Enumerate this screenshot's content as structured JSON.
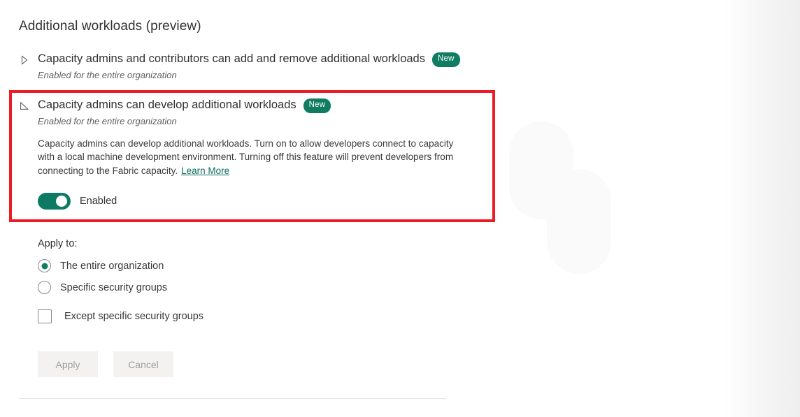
{
  "page": {
    "title": "Additional workloads (preview)"
  },
  "colors": {
    "accent_green": "#107c62",
    "toggle_on": "#0d7b63",
    "link": "#0f6b5c",
    "highlight_red": "#ed1c24",
    "text_primary": "#323130",
    "text_secondary": "#605e5c",
    "button_bg": "#f3f2f1",
    "button_text": "#a19f9d",
    "divider": "#e6e6e6"
  },
  "settings": [
    {
      "id": "capacity-admins-add-remove",
      "expanded": false,
      "expander_icon": "triangle-right-icon",
      "title": "Capacity admins and contributors can add and remove additional workloads",
      "badge": "New",
      "subtitle": "Enabled for the entire organization"
    },
    {
      "id": "capacity-admins-develop",
      "expanded": true,
      "expander_icon": "triangle-down-icon",
      "title": "Capacity admins can develop additional workloads",
      "badge": "New",
      "subtitle": "Enabled for the entire organization",
      "description": "Capacity admins can develop additional workloads. Turn on to allow developers connect to capacity with a local machine development environment. Turning off this feature will prevent developers from connecting to the Fabric capacity.",
      "learn_more": "Learn More",
      "toggle": {
        "state": "on",
        "label": "Enabled"
      }
    }
  ],
  "apply_to": {
    "label": "Apply to:",
    "options": [
      {
        "label": "The entire organization",
        "selected": true
      },
      {
        "label": "Specific security groups",
        "selected": false
      }
    ],
    "checkbox": {
      "label": "Except specific security groups",
      "checked": false
    }
  },
  "actions": {
    "apply_label": "Apply",
    "cancel_label": "Cancel"
  }
}
